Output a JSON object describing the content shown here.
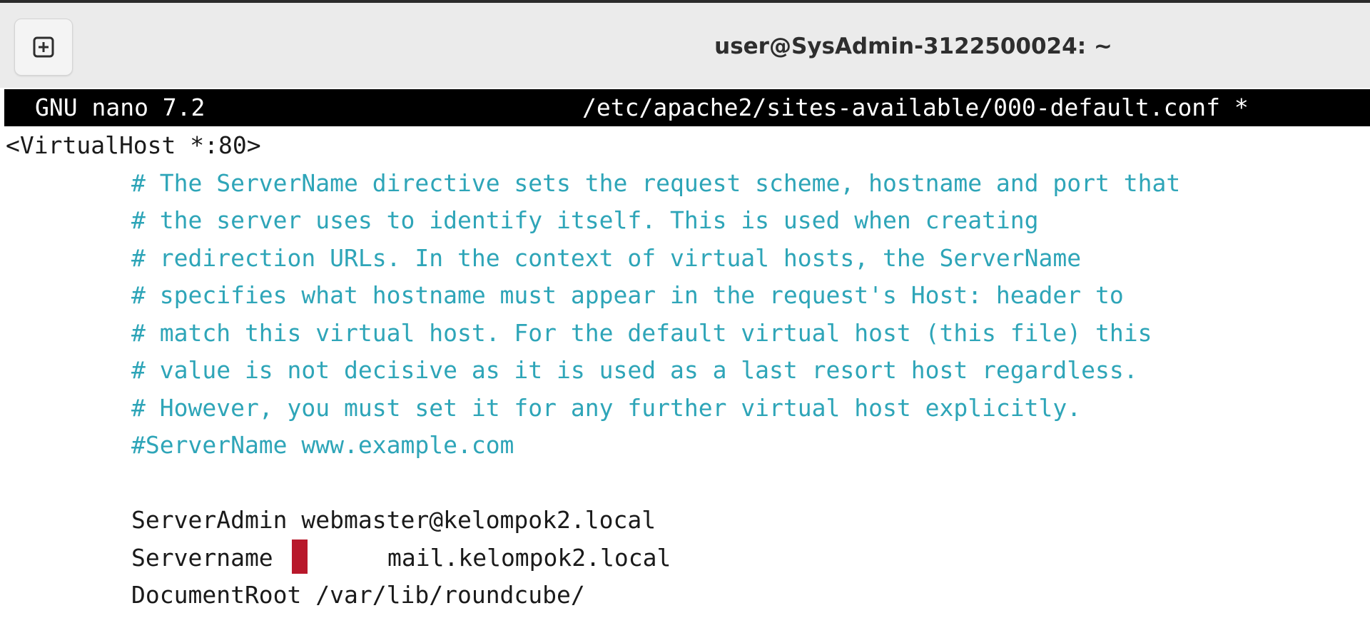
{
  "window": {
    "title": "user@SysAdmin-3122500024: ~",
    "new_tab_icon": "plus-square-icon"
  },
  "nano": {
    "version": "GNU nano 7.2",
    "filename": "/etc/apache2/sites-available/000-default.conf *"
  },
  "editor": {
    "lines": [
      "<VirtualHost *:80>",
      "# The ServerName directive sets the request scheme, hostname and port that",
      "# the server uses to identify itself. This is used when creating",
      "# redirection URLs. In the context of virtual hosts, the ServerName",
      "# specifies what hostname must appear in the request's Host: header to",
      "# match this virtual host. For the default virtual host (this file) this",
      "# value is not decisive as it is used as a last resort host regardless.",
      "# However, you must set it for any further virtual host explicitly.",
      "#ServerName www.example.com",
      "",
      "ServerAdmin webmaster@kelompok2.local",
      "Servername",
      "mail.kelompok2.local",
      "DocumentRoot /var/lib/roundcube/"
    ]
  },
  "colors": {
    "comment": "#2ea5b8",
    "cursor": "#b8182b",
    "header_bg": "#000000"
  }
}
